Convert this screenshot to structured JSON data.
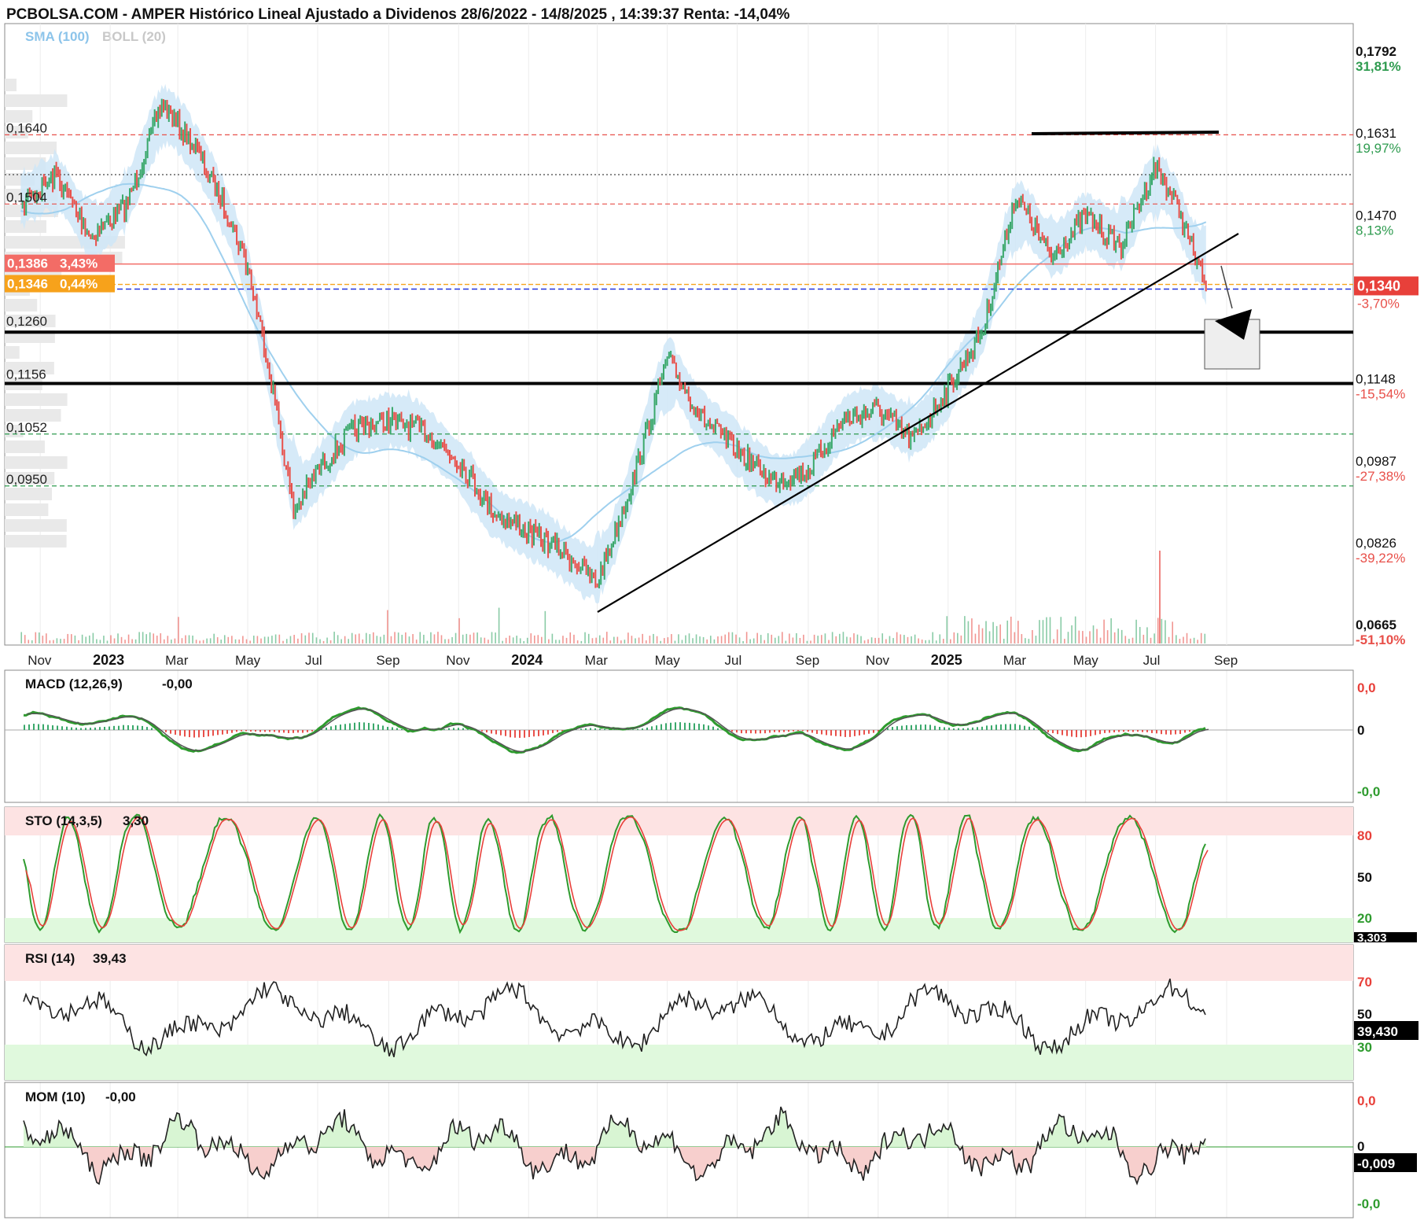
{
  "header": {
    "title": "PCBOLSA.COM - AMPER Histórico Lineal Ajustado a Dividenos 28/6/2022 - 14/8/2025 , 14:39:37 Renta: -14,04%",
    "legend_sma": "SMA (100)",
    "legend_boll": "BOLL (20)"
  },
  "colors": {
    "up": "#3aa86b",
    "down": "#e8504a",
    "band_fill": "#cfe6f7",
    "sma_line": "#9fd0ee",
    "support_line": "#000000",
    "sto_k": "#2e9b2e",
    "sto_d": "#e8403a",
    "macd": "#2e9b2e",
    "signal": "#555555"
  },
  "left_levels": [
    {
      "label": "0,1640",
      "value": 0.164
    },
    {
      "label": "0,1504",
      "value": 0.1504
    },
    {
      "label": "0,1260",
      "value": 0.126
    },
    {
      "label": "0,1156",
      "value": 0.1156
    },
    {
      "label": "0,1052",
      "value": 0.1052
    },
    {
      "label": "0,0950",
      "value": 0.095
    }
  ],
  "tags": [
    {
      "price": "0,1386",
      "pct": "3,43%",
      "color": "#f36c66",
      "value": 0.1386
    },
    {
      "price": "0,1346",
      "pct": "0,44%",
      "color": "#f7a21b",
      "value": 0.1346
    }
  ],
  "right_axis": [
    {
      "price": "0,1792",
      "pct": "31,81%",
      "pct_color": "green",
      "value": 0.1792
    },
    {
      "price": "0,1631",
      "pct": "19,97%",
      "pct_color": "green",
      "value": 0.1631
    },
    {
      "price": "0,1470",
      "pct": "8,13%",
      "pct_color": "green",
      "value": 0.147
    },
    {
      "price": "0,1148",
      "pct": "-15,54%",
      "pct_color": "red",
      "value": 0.1148
    },
    {
      "price": "0,0987",
      "pct": "-27,38%",
      "pct_color": "red",
      "value": 0.0987
    },
    {
      "price": "0,0826",
      "pct": "-39,22%",
      "pct_color": "red",
      "value": 0.0826
    },
    {
      "price": "0,0665",
      "pct": "-51,10%",
      "pct_color": "red",
      "value": 0.0665
    }
  ],
  "current": {
    "price": "0,1340",
    "pct": "-3,70%",
    "value": 0.134
  },
  "x_axis": [
    {
      "label": "Nov",
      "bold": false
    },
    {
      "label": "2023",
      "bold": true
    },
    {
      "label": "Mar",
      "bold": false
    },
    {
      "label": "May",
      "bold": false
    },
    {
      "label": "Jul",
      "bold": false
    },
    {
      "label": "Sep",
      "bold": false
    },
    {
      "label": "Nov",
      "bold": false
    },
    {
      "label": "2024",
      "bold": true
    },
    {
      "label": "Mar",
      "bold": false
    },
    {
      "label": "May",
      "bold": false
    },
    {
      "label": "Jul",
      "bold": false
    },
    {
      "label": "Sep",
      "bold": false
    },
    {
      "label": "Nov",
      "bold": false
    },
    {
      "label": "2025",
      "bold": true
    },
    {
      "label": "Mar",
      "bold": false
    },
    {
      "label": "May",
      "bold": false
    },
    {
      "label": "Jul",
      "bold": false
    },
    {
      "label": "Sep",
      "bold": false
    }
  ],
  "indicators": {
    "macd": {
      "label": "MACD (12,26,9)",
      "value": "-0,00",
      "axis_top": "0,0",
      "axis_mid": "0",
      "axis_bot": "-0,0"
    },
    "sto": {
      "label": "STO (14,3,5)",
      "value": "3,30",
      "axis": [
        "80",
        "50",
        "20"
      ],
      "current": "3,303"
    },
    "rsi": {
      "label": "RSI (14)",
      "value": "39,43",
      "axis": [
        "70",
        "50",
        "30"
      ],
      "current": "39,430"
    },
    "mom": {
      "label": "MOM (10)",
      "value": "-0,00",
      "axis_top": "0,0",
      "axis_mid": "0",
      "axis_bot": "-0,0",
      "current": "-0,009"
    }
  },
  "chart_data": [
    {
      "type": "line",
      "title": "PCBOLSA.COM - AMPER Histórico Lineal Ajustado a Dividenos 28/6/2022 - 14/8/2025 , 14:39:37 Renta: -14,04%",
      "x_range": [
        "2022-10",
        "2025-08"
      ],
      "ylim": [
        0.0665,
        0.1792
      ],
      "price_series": [
        [
          "2022-10-15",
          0.15
        ],
        [
          "2022-11-15",
          0.156
        ],
        [
          "2022-12-15",
          0.144
        ],
        [
          "2023-01-15",
          0.15
        ],
        [
          "2023-02-15",
          0.17
        ],
        [
          "2023-03-15",
          0.162
        ],
        [
          "2023-04-15",
          0.148
        ],
        [
          "2023-05-01",
          0.138
        ],
        [
          "2023-05-20",
          0.118
        ],
        [
          "2023-06-10",
          0.09
        ],
        [
          "2023-07-01",
          0.098
        ],
        [
          "2023-08-01",
          0.106
        ],
        [
          "2023-09-01",
          0.108
        ],
        [
          "2023-10-01",
          0.106
        ],
        [
          "2023-11-01",
          0.1
        ],
        [
          "2023-12-01",
          0.09
        ],
        [
          "2024-01-01",
          0.086
        ],
        [
          "2024-02-01",
          0.082
        ],
        [
          "2024-03-01",
          0.076
        ],
        [
          "2024-04-01",
          0.096
        ],
        [
          "2024-05-01",
          0.12
        ],
        [
          "2024-06-01",
          0.108
        ],
        [
          "2024-07-01",
          0.102
        ],
        [
          "2024-08-01",
          0.096
        ],
        [
          "2024-09-01",
          0.098
        ],
        [
          "2024-10-01",
          0.108
        ],
        [
          "2024-11-01",
          0.11
        ],
        [
          "2024-12-01",
          0.104
        ],
        [
          "2025-01-01",
          0.114
        ],
        [
          "2025-02-01",
          0.126
        ],
        [
          "2025-03-01",
          0.152
        ],
        [
          "2025-04-01",
          0.14
        ],
        [
          "2025-05-01",
          0.148
        ],
        [
          "2025-06-01",
          0.142
        ],
        [
          "2025-07-01",
          0.158
        ],
        [
          "2025-07-20",
          0.15
        ],
        [
          "2025-08-14",
          0.134
        ]
      ],
      "horizontal_levels": [
        0.164,
        0.1504,
        0.1386,
        0.1346,
        0.134,
        0.126,
        0.1156,
        0.1052,
        0.095
      ]
    },
    {
      "type": "line",
      "title": "STO (14,3,5)",
      "ylim": [
        0,
        100
      ],
      "reference_lines": [
        80,
        50,
        20
      ],
      "last_value": 3.3
    },
    {
      "type": "line",
      "title": "RSI (14)",
      "ylim": [
        0,
        100
      ],
      "reference_lines": [
        70,
        50,
        30
      ],
      "last_value": 39.43
    }
  ]
}
